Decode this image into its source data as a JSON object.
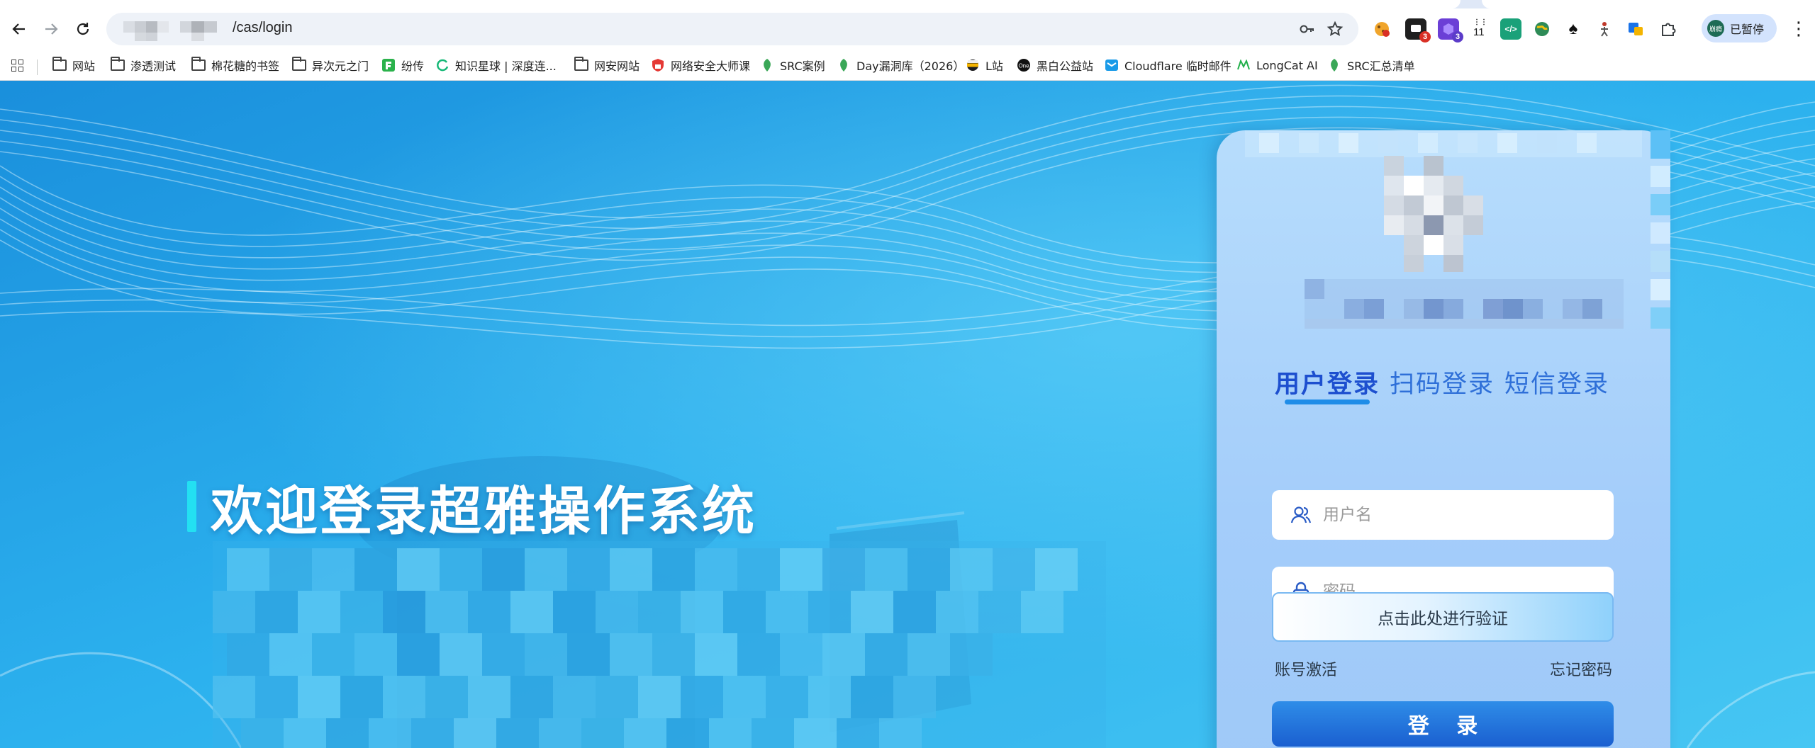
{
  "browser": {
    "url_suffix": "/cas/login",
    "paused_label": "已暂停",
    "paused_avatar_text": "崩瘾",
    "extension_badges": [
      "3",
      "3",
      "11"
    ],
    "bookmarks": [
      {
        "label": "网站",
        "icon": "folder-icon"
      },
      {
        "label": "渗透测试",
        "icon": "folder-icon"
      },
      {
        "label": "棉花糖的书签",
        "icon": "folder-icon"
      },
      {
        "label": "异次元之门",
        "icon": "folder-icon"
      },
      {
        "label": "纷传",
        "icon": "fenchuan-icon"
      },
      {
        "label": "知识星球 | 深度连...",
        "icon": "zsxq-icon"
      },
      {
        "label": "网安网站",
        "icon": "folder-icon"
      },
      {
        "label": "网络安全大师课",
        "icon": "shield-icon"
      },
      {
        "label": "SRC案例",
        "icon": "leaf-icon"
      },
      {
        "label": "Day漏洞库（2026）",
        "icon": "leaf-icon"
      },
      {
        "label": "L站",
        "icon": "linuxdo-icon"
      },
      {
        "label": "黑白公益站",
        "icon": "one-icon"
      },
      {
        "label": "Cloudflare 临时邮件",
        "icon": "mail-icon"
      },
      {
        "label": "LongCat AI",
        "icon": "longcat-icon"
      },
      {
        "label": "SRC汇总清单",
        "icon": "leaf-icon"
      }
    ]
  },
  "page": {
    "welcome_title": "欢迎登录超雅操作系统",
    "login": {
      "tabs": [
        {
          "label": "用户登录",
          "active": true
        },
        {
          "label": "扫码登录",
          "active": false
        },
        {
          "label": "短信登录",
          "active": false
        }
      ],
      "username_placeholder": "用户名",
      "password_placeholder": "密码",
      "verify_label": "点击此处进行验证",
      "activate_link": "账号激活",
      "forgot_link": "忘记密码",
      "submit_label": "登 录"
    }
  },
  "colors": {
    "accent": "#1d4fcf",
    "button": "#1a5fd0",
    "background": "#2fb2ee",
    "welcome_bar": "#23e0f2"
  }
}
